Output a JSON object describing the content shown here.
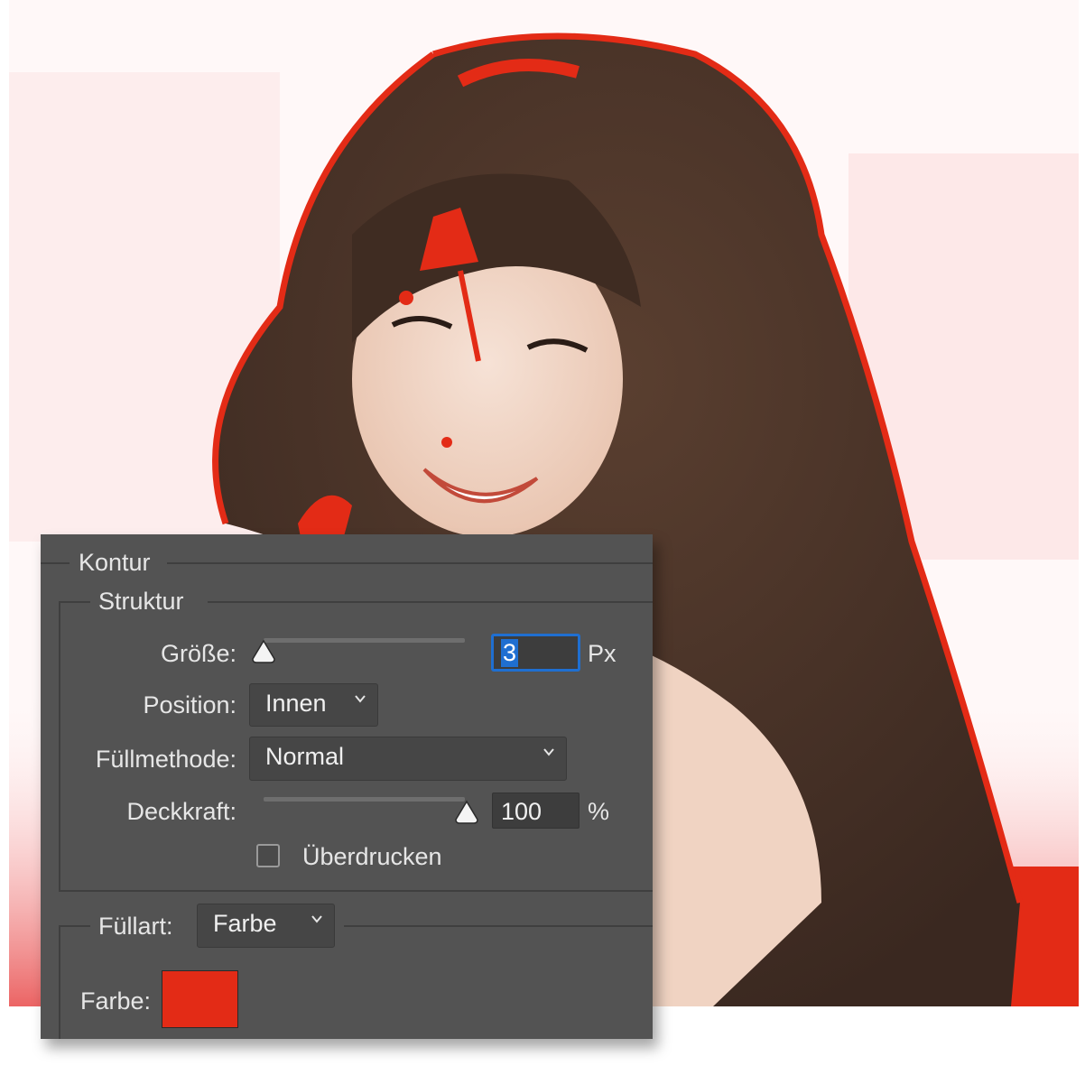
{
  "panel": {
    "section_title": "Kontur",
    "group_title": "Struktur",
    "size": {
      "label": "Größe:",
      "value": "3",
      "unit": "Px",
      "slider_fraction": 0.0
    },
    "position": {
      "label": "Position:",
      "value": "Innen"
    },
    "blend_mode": {
      "label": "Füllmethode:",
      "value": "Normal"
    },
    "opacity": {
      "label": "Deckkraft:",
      "value": "100",
      "unit": "%",
      "slider_fraction": 1.0
    },
    "overprint": {
      "label": "Überdrucken",
      "checked": false
    },
    "fill_type": {
      "label": "Füllart:",
      "value": "Farbe"
    },
    "color": {
      "label": "Farbe:",
      "swatch": "#e32b16"
    }
  },
  "colors": {
    "panel_bg": "#535353",
    "field_bg": "#3d3d3d",
    "focus_ring": "#1f6fd1",
    "stroke_red": "#e32b16"
  },
  "icons": {
    "dropdown": "chevron-down-icon",
    "slider_thumb": "triangle-thumb-icon"
  }
}
